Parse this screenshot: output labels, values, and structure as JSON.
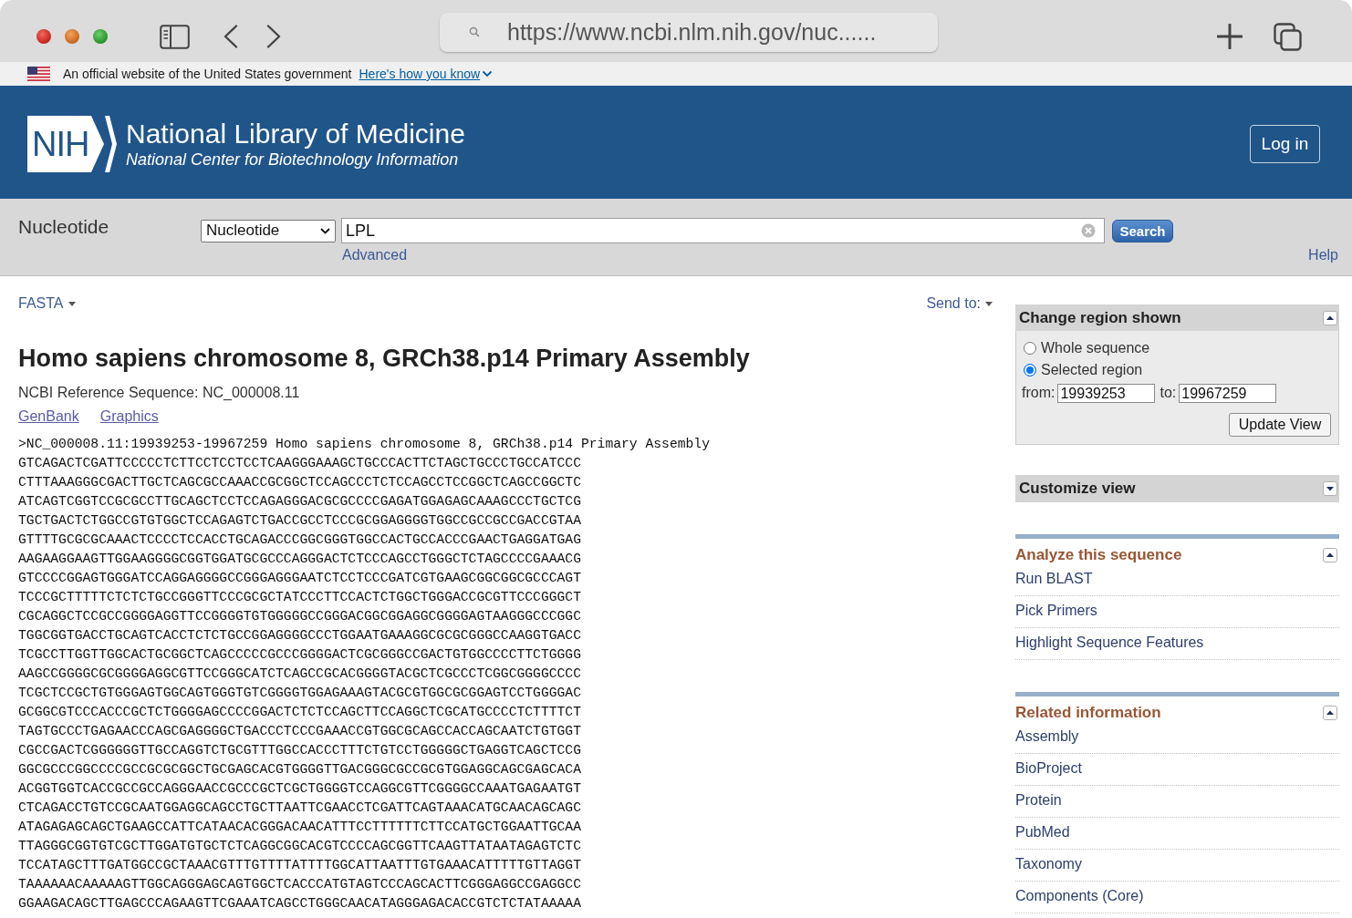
{
  "browser": {
    "url": "https://www.ncbi.nlm.nih.gov/nuc......"
  },
  "gov_banner": {
    "text": "An official website of the United States government",
    "link": "Here's how you know"
  },
  "header": {
    "logo": "NIH",
    "title": "National Library of Medicine",
    "subtitle": "National Center for Biotechnology Information",
    "login_button": "Log in"
  },
  "search_bar": {
    "database_label": "Nucleotide",
    "database_select": "Nucleotide",
    "query": "LPL",
    "search_button": "Search",
    "advanced_link": "Advanced",
    "help_link": "Help"
  },
  "content": {
    "format_menu": "FASTA",
    "send_to": "Send to:",
    "title": "Homo sapiens chromosome 8, GRCh38.p14 Primary Assembly",
    "reference": "NCBI Reference Sequence: NC_000008.11",
    "links": [
      "GenBank",
      "Graphics"
    ],
    "fasta_header": ">NC_000008.11:19939253-19967259 Homo sapiens chromosome 8, GRCh38.p14 Primary Assembly",
    "sequence_lines": [
      "GTCAGACTCGATTCCCCCTCTTCCTCCTCCTCAAGGGAAAGCTGCCCACTTCTAGCTGCCCTGCCATCCC",
      "CTTTAAAGGGCGACTTGCTCAGCGCCAAACCGCGGCTCCAGCCCTCTCCAGCCTCCGGCTCAGCCGGCTC",
      "ATCAGTCGGTCCGCGCCTTGCAGCTCCTCCAGAGGGACGCGCCCCGAGATGGAGAGCAAAGCCCTGCTCG",
      "TGCTGACTCTGGCCGTGTGGCTCCAGAGTCTGACCGCCTCCCGCGGAGGGGTGGCCGCCGCCGACCGTAA",
      "GTTTTGCGCGCAAACTCCCCTCCACCTGCAGACCCGGCGGGTGGCCACTGCCACCCGAACTGAGGATGAG",
      "AAGAAGGAAGTTGGAAGGGGCGGTGGATGCGCCCAGGGACTCTCCCAGCCTGGGCTCTAGCCCCGAAACG",
      "GTCCCCGGAGTGGGATCCAGGAGGGGCCGGGAGGGAATCTCCTCCCGATCGTGAAGCGGCGGCGCCCAGT",
      "TCCCGCTTTTTCTCTCTGCCGGGTTCCCGCGCTATCCCTTCCACTCTGGCTGGGACCGCGTTCCCGGGCT",
      "CGCAGGCTCCGCCGGGGAGGTTCCGGGGTGTGGGGGCCGGGACGGCGGAGGCGGGGAGTAAGGGCCCGGC",
      "TGGCGGTGACCTGCAGTCACCTCTCTGCCGGAGGGGCCCTGGAATGAAAGGCGCGCGGGCCAAGGTGACC",
      "TCGCCTTGGTTGGCACTGCGGCTCAGCCCCCGCCCGGGGACTCGCGGGCCGACTGTGGCCCCTTCTGGGG",
      "AAGCCGGGGCGCGGGGAGGCGTTCCGGGCATCTCAGCCGCACGGGGTACGCTCGCCCTCGGCGGGGCCCC",
      "TCGCTCCGCTGTGGGAGTGGCAGTGGGTGTCGGGGTGGAGAAAGTACGCGTGGCGCGGAGTCCTGGGGAC",
      "GCGGCGTCCCACCCGCTCTGGGGAGCCCCGGACTCTCTCCAGCTTCCAGGCTCGCATGCCCCTCTTTTCT",
      "TAGTGCCCTGAGAACCCAGCGAGGGGCTGACCCTCCCGAAACCGTGGCGCAGCCACCAGCAATCTGTGGT",
      "CGCCGACTCGGGGGGTTGCCAGGTCTGCGTTTGGCCACCCTTTCTGTCCTGGGGGCTGAGGTCAGCTCCG",
      "GGCGCCCGGCCCCGCCGCGCGGCTGCGAGCACGTGGGGTTGACGGGCGCCGCGTGGAGGCAGCGAGCACA",
      "ACGGTGGTCACCGCCGCCAGGGAACCGCCCGCTCGCTGGGGTCCAGGCGTTCGGGGCCAAATGAGAATGT",
      "CTCAGACCTGTCCGCAATGGAGGCAGCCTGCTTAATTCGAACCTCGATTCAGTAAACATGCAACAGCAGC",
      "ATAGAGAGCAGCTGAAGCCATTCATAACACGGGACAACATTTCCTTTTTTCTTCCATGCTGGAATTGCAA",
      "TTAGGGCGGTGTCGCTTGGATGTGCTCTCAGGCGGCACGTCCCCAGCGGTTCAAGTTATAATAGAGTCTC",
      "TCCATAGCTTTGATGGCCGCTAAACGTTTGTTTTATTTTGGCATTAATTTGTGAAACATTTTTGTTAGGT",
      "TAAAAAACAAAAAGTTGGCAGGGAGCAGTGGCTCACCCATGTAGTCCCAGCACTTCGGGAGGCCGAGGCC",
      "GGAAGACAGCTTGAGCCCAGAAGTTCGAAATCAGCCTGGGCAACATAGGGAGACACCGTCTCTATAAAAA"
    ]
  },
  "sidebar": {
    "region_panel": {
      "title": "Change region shown",
      "expanded": true,
      "options": [
        {
          "label": "Whole sequence",
          "selected": false
        },
        {
          "label": "Selected region",
          "selected": true
        }
      ],
      "from_label": "from:",
      "from_value": "19939253",
      "to_label": "to:",
      "to_value": "19967259",
      "button": "Update View"
    },
    "customize_panel": {
      "title": "Customize view",
      "expanded": false
    },
    "sections": [
      {
        "title": "Analyze this sequence",
        "expanded": true,
        "links": [
          "Run BLAST",
          "Pick Primers",
          "Highlight Sequence Features"
        ]
      },
      {
        "title": "Related information",
        "expanded": true,
        "links": [
          "Assembly",
          "BioProject",
          "Protein",
          "PubMed",
          "Taxonomy",
          "Components (Core)"
        ]
      }
    ]
  }
}
